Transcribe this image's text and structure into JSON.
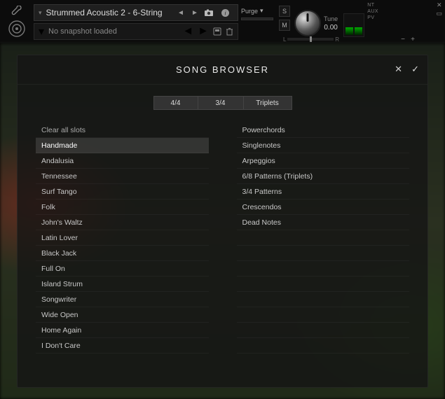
{
  "header": {
    "instrument_name": "Strummed Acoustic 2 - 6-String",
    "snapshot_text": "No snapshot loaded",
    "purge_label": "Purge",
    "tune_label": "Tune",
    "tune_value": "0.00",
    "solo_label": "S",
    "mute_label": "M",
    "pan_left": "L",
    "pan_right": "R",
    "side_labels": [
      "NT",
      "AUX",
      "PV"
    ]
  },
  "browser": {
    "title": "SONG BROWSER",
    "filters": {
      "a": "4/4",
      "b": "3/4",
      "c": "Triplets"
    },
    "left_list": [
      "Clear all slots",
      "Handmade",
      "Andalusia",
      "Tennessee",
      "Surf Tango",
      "Folk",
      "John's Waltz",
      "Latin Lover",
      "Black Jack",
      "Full On",
      "Island Strum",
      "Songwriter",
      "Wide Open",
      "Home Again",
      "I Don't Care"
    ],
    "left_selected_index": 1,
    "right_list": [
      "Powerchords",
      "Singlenotes",
      "Arpeggios",
      "6/8 Patterns (Triplets)",
      "3/4 Patterns",
      "Crescendos",
      "Dead Notes",
      "",
      "",
      "",
      "",
      "",
      "",
      "",
      ""
    ]
  }
}
